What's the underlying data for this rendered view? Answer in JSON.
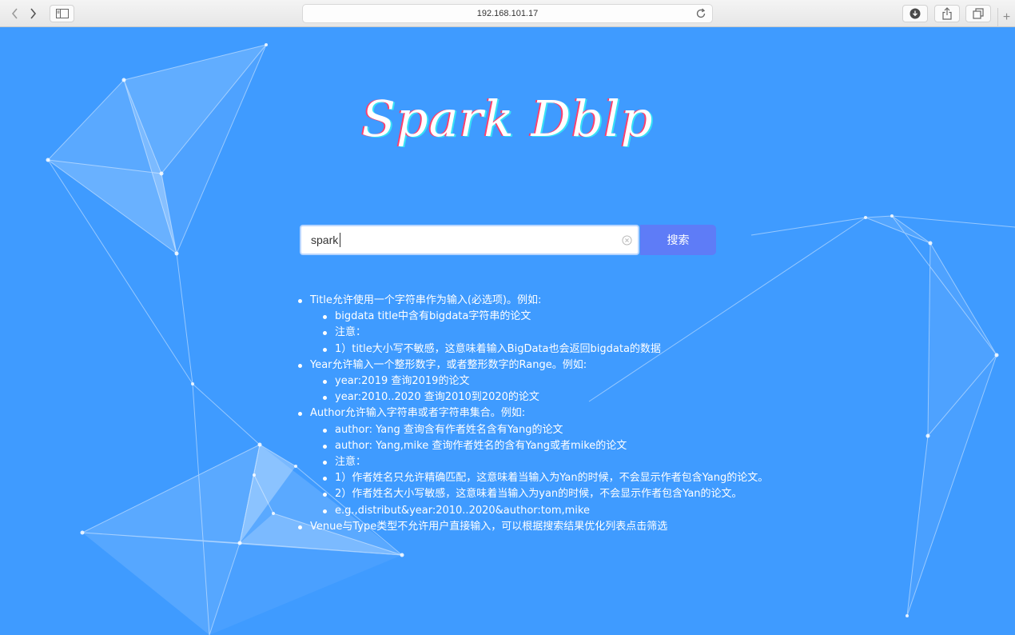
{
  "browser": {
    "url": "192.168.101.17",
    "back_icon": "chevron-left-icon",
    "forward_icon": "chevron-right-icon",
    "sidebar_icon": "sidebar-icon",
    "reload_icon": "reload-icon",
    "download_icon": "download-icon",
    "share_icon": "share-icon",
    "tabs_icon": "tabs-icon",
    "new_tab_label": "+"
  },
  "page": {
    "logo": "Spark Dblp",
    "background_color": "#3f9bff",
    "search": {
      "value": "spark",
      "button_label": "搜索",
      "button_color": "#5e7cf7"
    },
    "help": {
      "title": {
        "label": "Title允许使用一个字符串作为输入(必选项)。例如:",
        "items": [
          "bigdata title中含有bigdata字符串的论文",
          "注意：",
          "1）title大小写不敏感，这意味着输入BigData也会返回bigdata的数据"
        ]
      },
      "year": {
        "label": "Year允许输入一个整形数字，或者整形数字的Range。例如:",
        "items": [
          "year:2019 查询2019的论文",
          "year:2010..2020 查询2010到2020的论文"
        ]
      },
      "author": {
        "label": "Author允许输入字符串或者字符串集合。例如:",
        "items": [
          "author: Yang 查询含有作者姓名含有Yang的论文",
          "author: Yang,mike 查询作者姓名的含有Yang或者mike的论文",
          "注意：",
          "1）作者姓名只允许精确匹配，这意味着当输入为Yan的时候，不会显示作者包含Yang的论文。",
          "2）作者姓名大小写敏感，这意味着当输入为yan的时候，不会显示作者包含Yan的论文。",
          "e.g.,distribut&year:2010..2020&author:tom,mike"
        ]
      },
      "venue": {
        "label": "Venue与Type类型不允许用户直接输入，可以根据搜索结果优化列表点击筛选"
      }
    }
  }
}
